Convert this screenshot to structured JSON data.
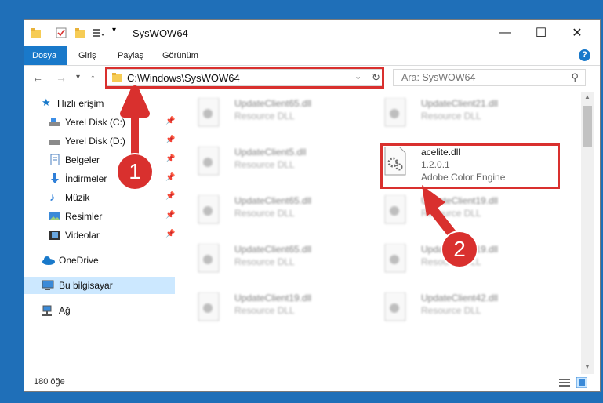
{
  "window": {
    "title": "SysWOW64",
    "minimize_glyph": "—",
    "maximize_glyph": "☐",
    "close_glyph": "✕"
  },
  "ribbon": {
    "tabs": [
      {
        "label": "Dosya",
        "active": true
      },
      {
        "label": "Giriş",
        "active": false
      },
      {
        "label": "Paylaş",
        "active": false
      },
      {
        "label": "Görünüm",
        "active": false
      }
    ],
    "help_glyph": "?"
  },
  "address": {
    "path": "C:\\Windows\\SysWOW64",
    "search_placeholder": "Ara: SysWOW64"
  },
  "sidebar": {
    "items": [
      {
        "label": "Hızlı erişim",
        "icon": "star-icon"
      },
      {
        "label": "Yerel Disk (C:)",
        "icon": "drive-icon",
        "pinned": true
      },
      {
        "label": "Yerel Disk (D:)",
        "icon": "drive-icon",
        "pinned": true
      },
      {
        "label": "Belgeler",
        "icon": "documents-icon",
        "pinned": true
      },
      {
        "label": "İndirmeler",
        "icon": "download-icon",
        "pinned": true
      },
      {
        "label": "Müzik",
        "icon": "music-icon",
        "pinned": true
      },
      {
        "label": "Resimler",
        "icon": "pictures-icon",
        "pinned": true
      },
      {
        "label": "Videolar",
        "icon": "videos-icon",
        "pinned": true
      },
      {
        "label": "OneDrive",
        "icon": "cloud-icon"
      },
      {
        "label": "Bu bilgisayar",
        "icon": "computer-icon",
        "selected": true
      },
      {
        "label": "Ağ",
        "icon": "network-icon"
      }
    ]
  },
  "files": [
    {
      "name": "UpdateClient65.dll",
      "line2": "Resource DLL",
      "line3": "",
      "blurred": true
    },
    {
      "name": "UpdateClient21.dll",
      "line2": "Resource DLL",
      "line3": "",
      "blurred": true
    },
    {
      "name": "UpdateClient5.dll",
      "line2": "Resource DLL",
      "line3": "",
      "blurred": true
    },
    {
      "name": "acelite.dll",
      "line2": "1.2.0.1",
      "line3": "Adobe Color Engine",
      "blurred": false
    },
    {
      "name": "UpdateClient65.dll",
      "line2": "Resource DLL",
      "line3": "",
      "blurred": true
    },
    {
      "name": "UpdateClient19.dll",
      "line2": "Resource DLL",
      "line3": "",
      "blurred": true
    },
    {
      "name": "UpdateClient65.dll",
      "line2": "Resource DLL",
      "line3": "",
      "blurred": true
    },
    {
      "name": "UpdateClient19.dll",
      "line2": "Resource DLL",
      "line3": "",
      "blurred": true
    },
    {
      "name": "UpdateClient19.dll",
      "line2": "Resource DLL",
      "line3": "",
      "blurred": true
    },
    {
      "name": "UpdateClient42.dll",
      "line2": "Resource DLL",
      "line3": "",
      "blurred": true
    }
  ],
  "status": {
    "count": "180 öğe"
  },
  "annotations": {
    "step1": "1",
    "step2": "2",
    "color": "#d9302e"
  }
}
